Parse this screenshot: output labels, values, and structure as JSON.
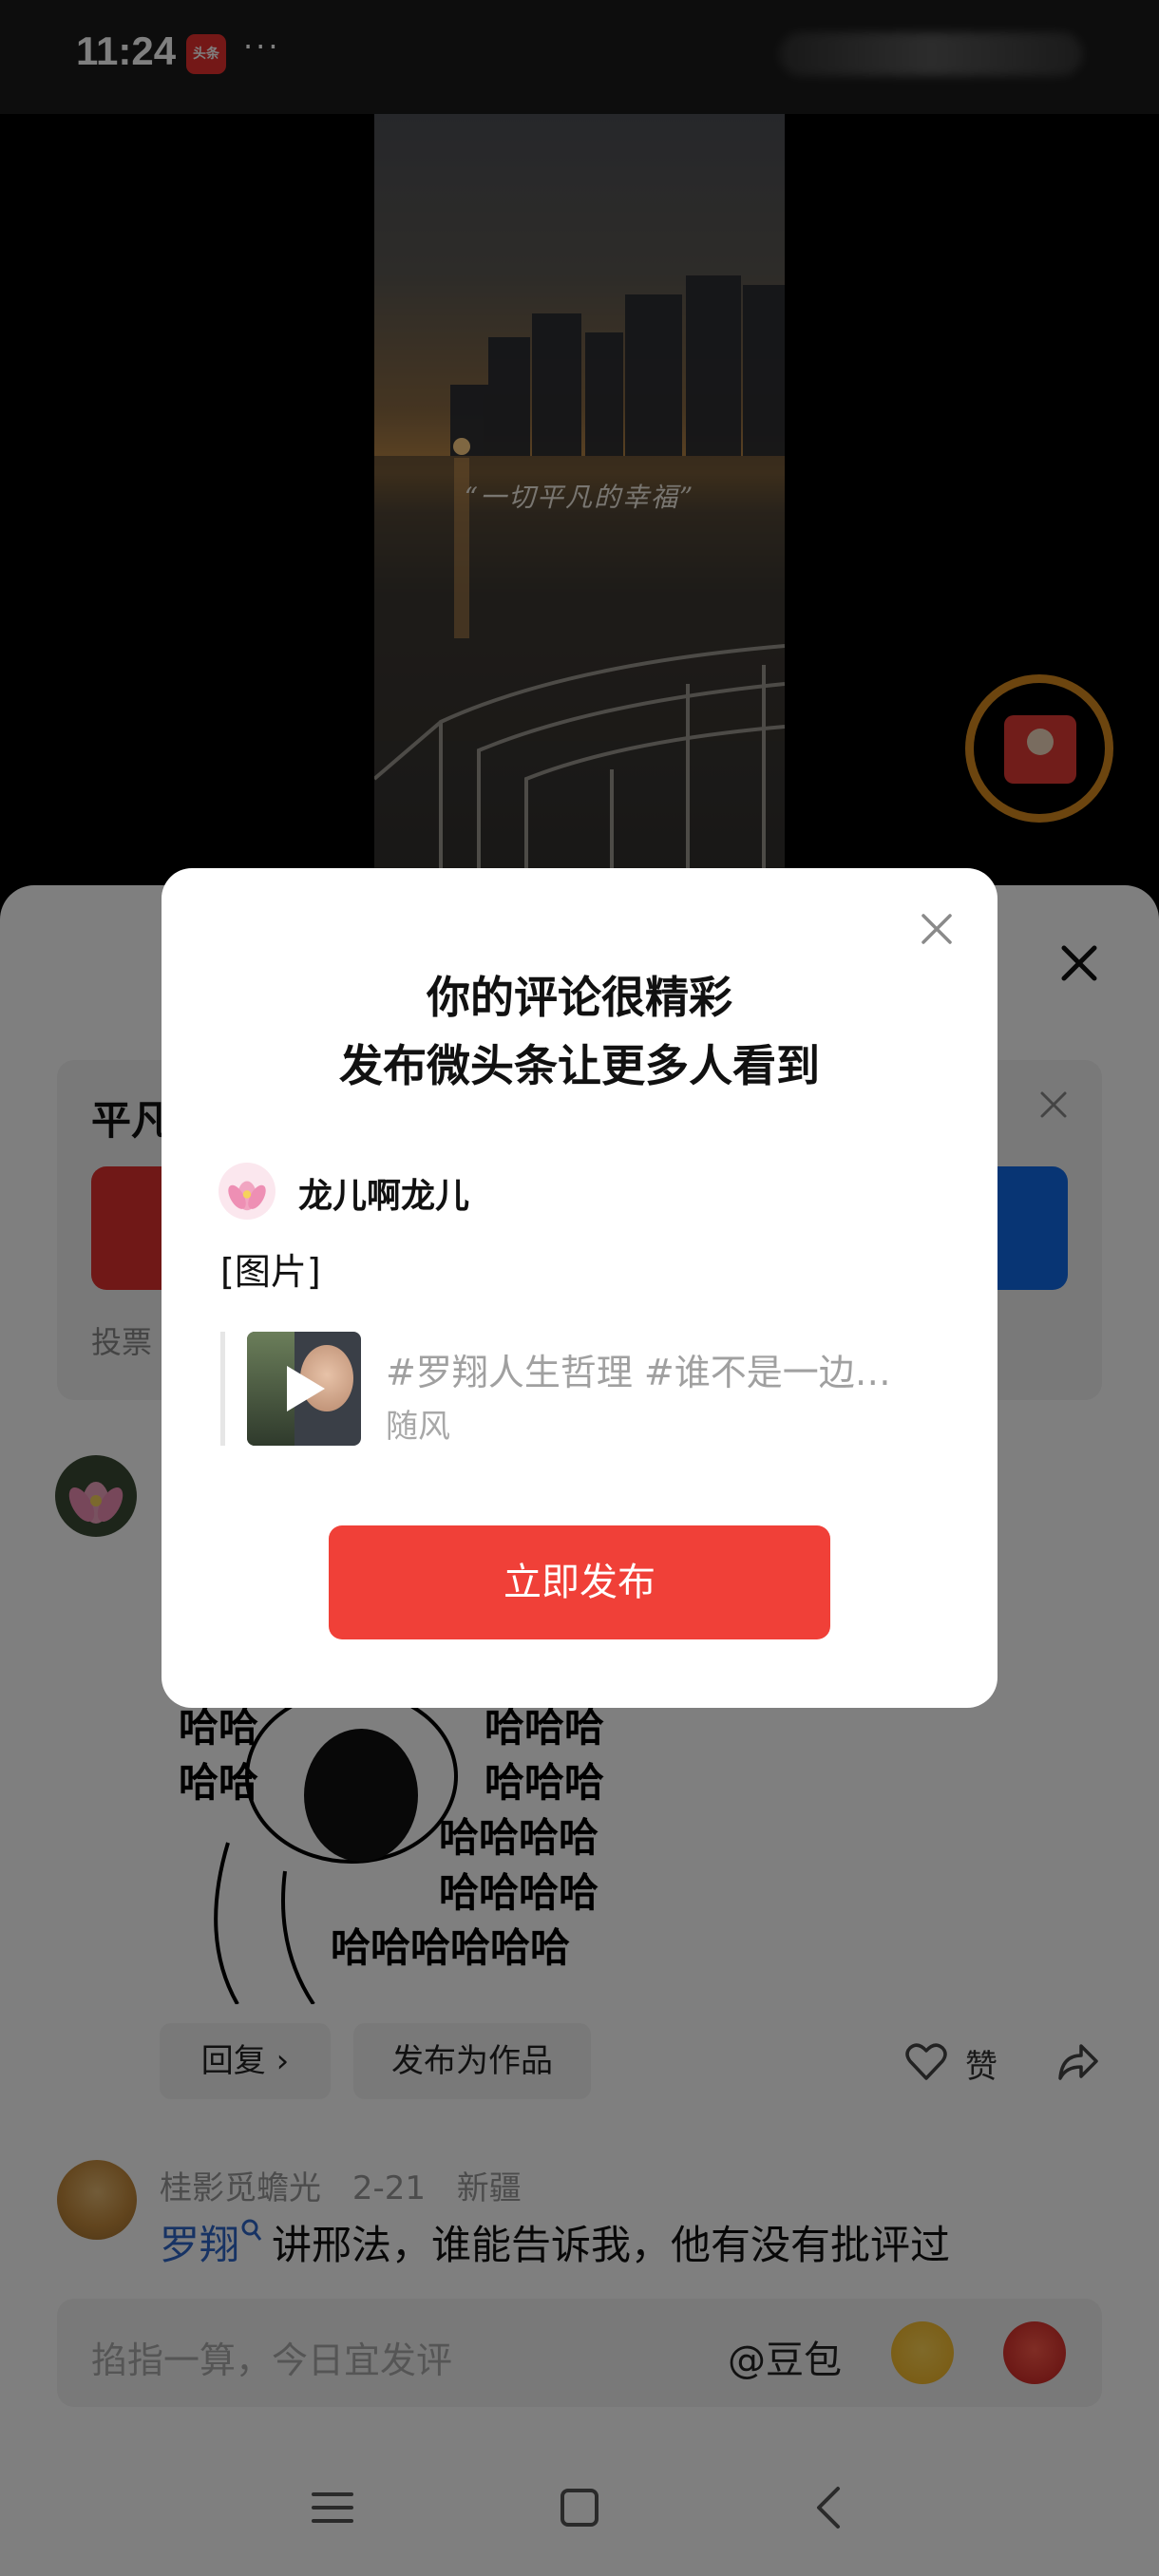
{
  "status_bar": {
    "time": "11:24",
    "app_badge": "头条",
    "dots": "···"
  },
  "video": {
    "overlay_text": "“一切平凡的幸福”"
  },
  "vote_card": {
    "title": "平凡",
    "footer": "投票"
  },
  "comment": {
    "meme_lines": [
      "哈哈",
      "哈哈",
      "哈哈哈",
      "哈哈哈",
      "哈哈哈哈",
      "哈哈哈哈",
      "哈哈哈哈哈哈"
    ],
    "reply_label": "回复 ›",
    "publish_work_label": "发布为作品",
    "like_label": "赞"
  },
  "comment2": {
    "username": "桂影觅蟾光",
    "date": "2-21",
    "location": "新疆",
    "mention": "罗翔",
    "text": "讲邢法，谁能告诉我，他有没有批评过"
  },
  "input_bar": {
    "placeholder": "掐指一算，今日宜发评",
    "doubao": "@豆包"
  },
  "dialog": {
    "title_line1": "你的评论很精彩",
    "title_line2": "发布微头条让更多人看到",
    "user_name": "龙儿啊龙儿",
    "image_tag": "[图片]",
    "video_title": "#罗翔人生哲理 #谁不是一边…",
    "video_author": "随风",
    "publish_button": "立即发布"
  },
  "colors": {
    "accent_red": "#f04038",
    "vote_red": "#e0312f",
    "vote_blue": "#116be8",
    "mention_blue": "#2f66c8",
    "ring_orange": "#d98a1f"
  }
}
